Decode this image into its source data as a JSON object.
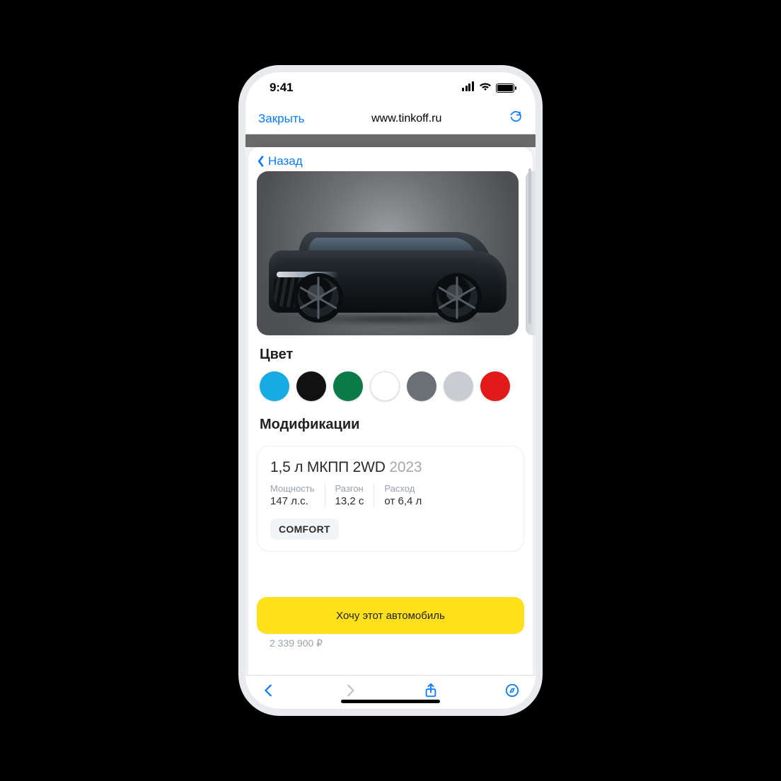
{
  "status": {
    "time": "9:41"
  },
  "browser": {
    "close_label": "Закрыть",
    "url": "www.tinkoff.ru"
  },
  "sheet": {
    "back_label": "Назад",
    "sections": {
      "color_heading": "Цвет",
      "colors": [
        {
          "name": "blue",
          "hex": "#17abe3"
        },
        {
          "name": "black",
          "hex": "#111111"
        },
        {
          "name": "green",
          "hex": "#0a7b46"
        },
        {
          "name": "white",
          "hex": "#ffffff"
        },
        {
          "name": "gray",
          "hex": "#6b7076"
        },
        {
          "name": "silver",
          "hex": "#c9ccd1"
        },
        {
          "name": "red",
          "hex": "#e21a1a"
        }
      ],
      "mods_heading": "Модификации",
      "modification": {
        "title_main": "1,5 л МКПП 2WD",
        "title_year": "2023",
        "specs": [
          {
            "label": "Мощность",
            "value": "147 л.с."
          },
          {
            "label": "Разгон",
            "value": "13,2 с"
          },
          {
            "label": "Расход",
            "value": "от 6,4 л"
          }
        ],
        "trim_label": "COMFORT",
        "price": "2 339 900 ₽"
      }
    },
    "cta_label": "Хочу этот автомобиль"
  }
}
